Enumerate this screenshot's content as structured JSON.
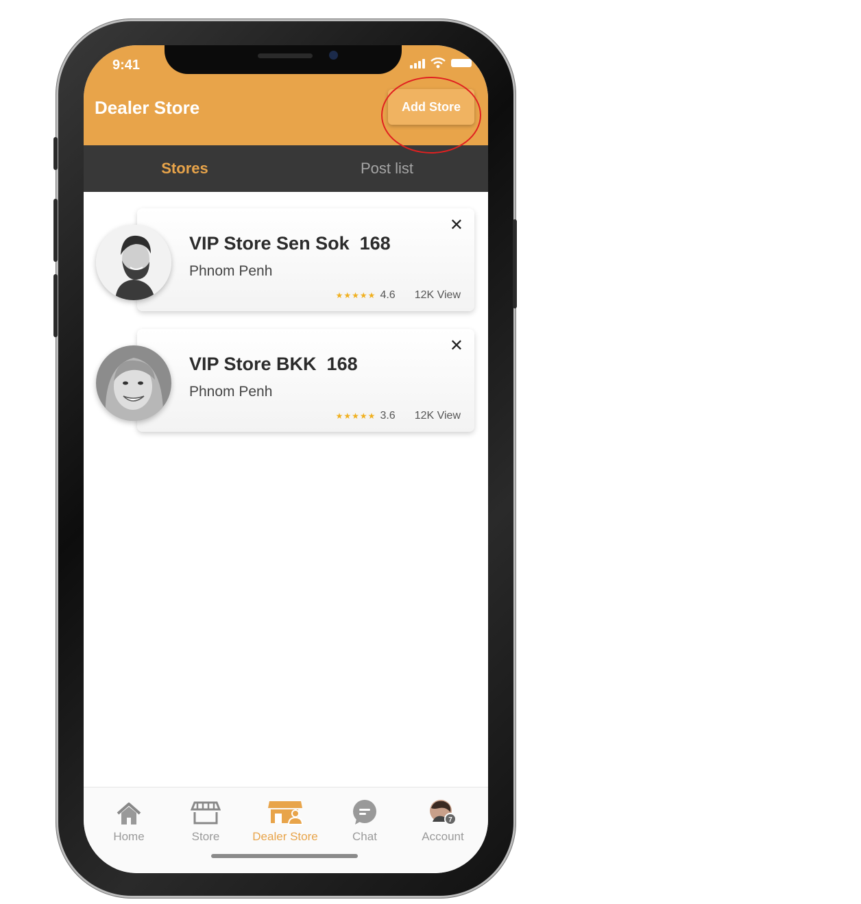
{
  "status_bar": {
    "time": "9:41"
  },
  "header": {
    "title": "Dealer Store",
    "add_store_label": "Add Store",
    "accent_color": "#e8a44a"
  },
  "tabs": [
    {
      "label": "Stores",
      "active": true
    },
    {
      "label": "Post list",
      "active": false
    }
  ],
  "stores": [
    {
      "name": "VIP Store Sen Sok  168",
      "location": "Phnom Penh",
      "stars": "★★★★★",
      "rating": "4.6",
      "views": "12K View",
      "avatar": "man-with-beard"
    },
    {
      "name": "VIP Store BKK  168",
      "location": "Phnom Penh",
      "stars": "★★★★★",
      "rating": "3.6",
      "views": "12K View",
      "avatar": "smiling-woman"
    }
  ],
  "bottom_nav": [
    {
      "label": "Home",
      "icon": "home-icon",
      "active": false
    },
    {
      "label": "Store",
      "icon": "store-icon",
      "active": false
    },
    {
      "label": "Dealer Store",
      "icon": "dealer-store-icon",
      "active": true
    },
    {
      "label": "Chat",
      "icon": "chat-icon",
      "active": false
    },
    {
      "label": "Account",
      "icon": "account-avatar-icon",
      "active": false
    }
  ],
  "account_badge": "7"
}
